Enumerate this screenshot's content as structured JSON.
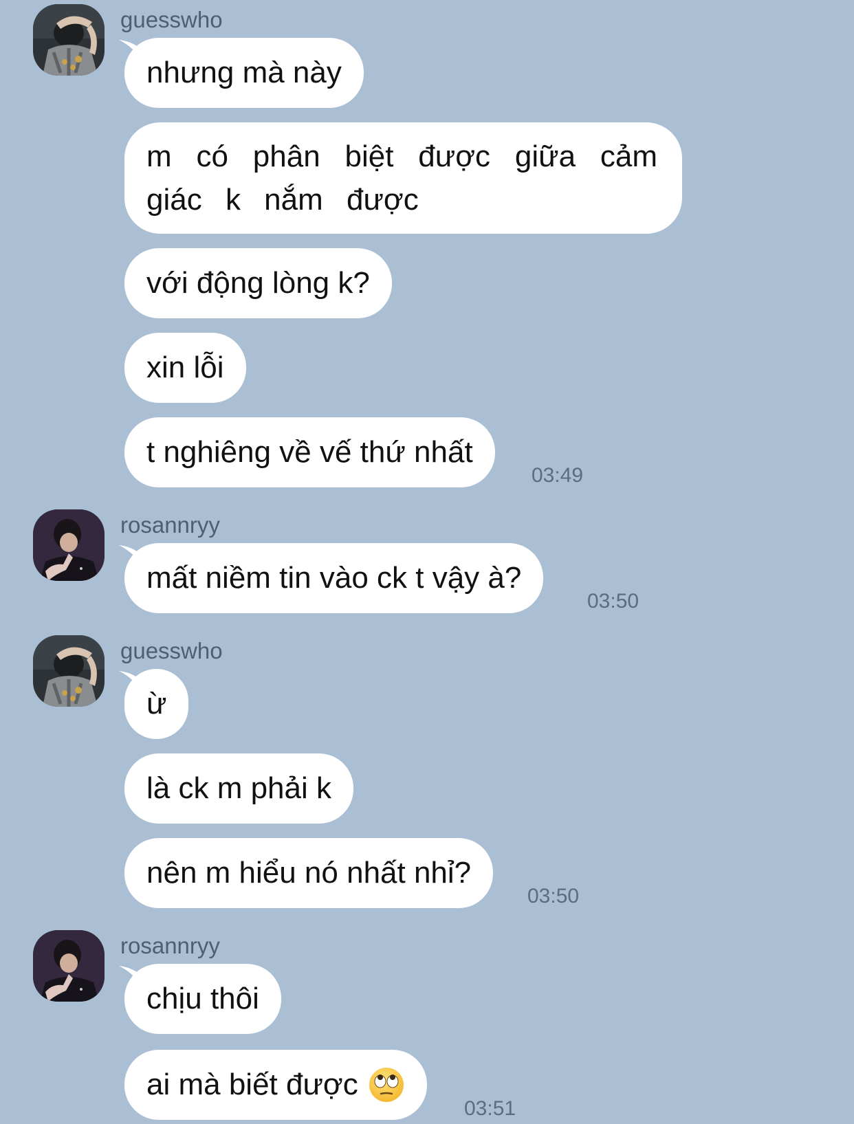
{
  "colors": {
    "background": "#aabfd3",
    "bubble": "#ffffff",
    "text": "#111111",
    "meta": "#4f5f71"
  },
  "groups": [
    {
      "sender": "guesswho",
      "avatar_icon": "guesswho-avatar",
      "messages": [
        "nhưng mà này",
        "m có phân biệt được giữa cảm giác k nắm được",
        "với động lòng k?",
        "xin lỗi",
        "t nghiêng về vế thứ nhất"
      ],
      "time": "03:49"
    },
    {
      "sender": "rosannryy",
      "avatar_icon": "rosannryy-avatar",
      "messages": [
        "mất niềm tin vào ck t vậy à?"
      ],
      "time": "03:50"
    },
    {
      "sender": "guesswho",
      "avatar_icon": "guesswho-avatar",
      "messages": [
        "ừ",
        "là ck m phải k",
        "nên m hiểu nó nhất nhỉ?"
      ],
      "time": "03:50"
    },
    {
      "sender": "rosannryy",
      "avatar_icon": "rosannryy-avatar",
      "messages": [
        "chịu thôi",
        "ai mà biết được"
      ],
      "emoji_icon": "eye-roll-emoji",
      "time": "03:51"
    }
  ]
}
